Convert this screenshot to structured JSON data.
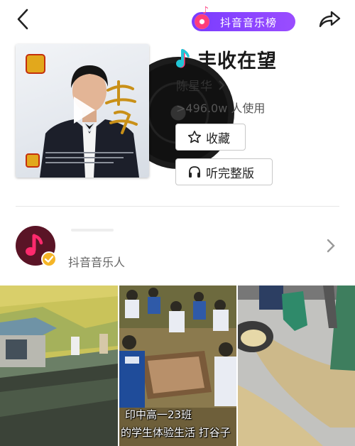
{
  "header": {
    "chart_badge_label": "抖音音乐榜"
  },
  "song": {
    "title": "丰收在望",
    "artist": "陈星华",
    "usage": ">496.0w 人使用"
  },
  "actions": {
    "favorite_label": "收藏",
    "full_version_label": "听完整版"
  },
  "creator": {
    "name": "抖音音乐人"
  },
  "videos": [
    {
      "caption_lines": []
    },
    {
      "caption_lines": [
        "印中高一23班",
        "的学生体验生活 打谷子"
      ]
    },
    {
      "caption_lines": []
    }
  ],
  "colors": {
    "badge_gradient_start": "#7a3cff",
    "badge_gradient_end": "#9a4dff",
    "avatar_badge": "#f5b527",
    "music_note_cyan": "#21c6d6",
    "music_note_pink": "#ff3d7a"
  },
  "icons": {
    "back": "chevron-left-icon",
    "share": "share-arrow-icon",
    "favorite": "star-outline-icon",
    "full_version": "headphones-icon",
    "title_note": "music-note-icon",
    "artist_link": "chevron-right-icon",
    "creator_link": "chevron-right-icon"
  }
}
